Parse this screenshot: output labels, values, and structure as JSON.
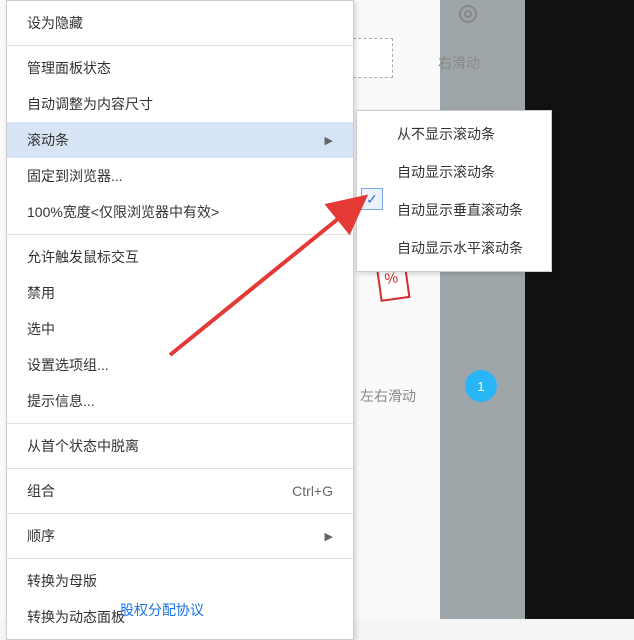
{
  "menu": {
    "items": [
      {
        "label": "设为隐藏"
      },
      {
        "label": "管理面板状态"
      },
      {
        "label": "自动调整为内容尺寸"
      },
      {
        "label": "滚动条",
        "hasSubmenu": true,
        "highlighted": true
      },
      {
        "label": "固定到浏览器..."
      },
      {
        "label": "100%宽度<仅限浏览器中有效>"
      },
      {
        "label": "允许触发鼠标交互"
      },
      {
        "label": "禁用"
      },
      {
        "label": "选中"
      },
      {
        "label": "设置选项组..."
      },
      {
        "label": "提示信息..."
      },
      {
        "label": "从首个状态中脱离"
      },
      {
        "label": "组合",
        "shortcut": "Ctrl+G"
      },
      {
        "label": "顺序",
        "hasSubmenu": true
      },
      {
        "label": "转换为母版"
      },
      {
        "label": "转换为动态面板"
      }
    ]
  },
  "submenu": {
    "items": [
      {
        "label": "从不显示滚动条"
      },
      {
        "label": "自动显示滚动条"
      },
      {
        "label": "自动显示垂直滚动条"
      },
      {
        "label": "自动显示水平滚动条"
      }
    ]
  },
  "background": {
    "slideLabel": "左右滑动",
    "slideLabelTop": "右滑动",
    "badgeNumber": "1",
    "bottomLink": "股权分配协议"
  }
}
